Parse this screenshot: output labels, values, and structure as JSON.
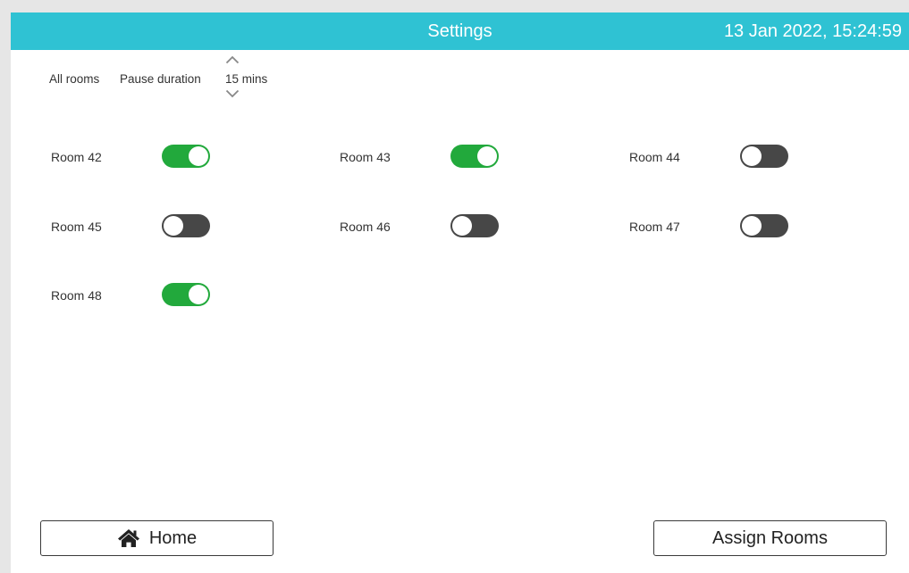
{
  "header": {
    "title": "Settings",
    "datetime": "13 Jan 2022, 15:24:59",
    "background_color": "#2fc2d3"
  },
  "controls": {
    "all_rooms_label": "All rooms",
    "pause_duration_label": "Pause duration",
    "pause_duration_value": "15 mins",
    "increase_icon": "chevron-up-icon",
    "decrease_icon": "chevron-down-icon"
  },
  "rooms": [
    {
      "label": "Room 42",
      "enabled": true
    },
    {
      "label": "Room 43",
      "enabled": true
    },
    {
      "label": "Room 44",
      "enabled": false
    },
    {
      "label": "Room 45",
      "enabled": false
    },
    {
      "label": "Room 46",
      "enabled": false
    },
    {
      "label": "Room 47",
      "enabled": false
    },
    {
      "label": "Room 48",
      "enabled": true
    }
  ],
  "colors": {
    "toggle_on": "#22a93c",
    "toggle_off": "#474747"
  },
  "footer": {
    "home_label": "Home",
    "home_icon": "home-icon",
    "assign_label": "Assign Rooms"
  }
}
